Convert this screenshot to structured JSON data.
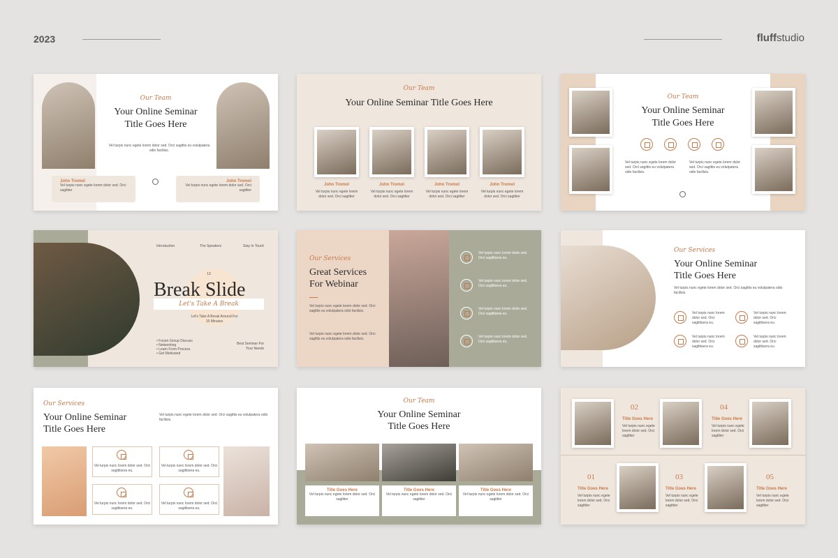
{
  "header": {
    "year": "2023",
    "brand_a": "fluff",
    "brand_b": "studio"
  },
  "common": {
    "our_team": "Our Team",
    "our_services": "Our Services",
    "title_line1": "Your Online Seminar",
    "title_line2": "Title Goes Here",
    "title_single": "Your Online Seminar Title Goes Here",
    "person": "John Tromol",
    "title_goes_here": "Title Goes Here",
    "lorem_a": "Vel turpis nunc egete lorem dolor sed. Orci sagittis eu volutpatera odio facilisis.",
    "lorem_b": "Vel turpis nunc egete lorem dolor sed. Orci sagittier",
    "lorem_c": "Vel turpis nunc lorem dolor sed. Orci sagittisera eu."
  },
  "break_slide": {
    "nav": [
      "Introduction",
      "The Speakers",
      "Stay In Touch"
    ],
    "number": "13",
    "title": "Break Slide",
    "subtitle": "Let's Take A Break",
    "note": "Let's Take A Break Around For 15 Minutes",
    "bullets": [
      "Forum Group Discuss",
      "Networking",
      "Learn From Process",
      "Get Motivated"
    ],
    "best": "Best Seminar For Your Needs"
  },
  "services": {
    "title_line1": "Great Services",
    "title_line2": "For Webinar"
  },
  "timeline": {
    "steps": [
      "01",
      "02",
      "03",
      "04",
      "05"
    ]
  }
}
